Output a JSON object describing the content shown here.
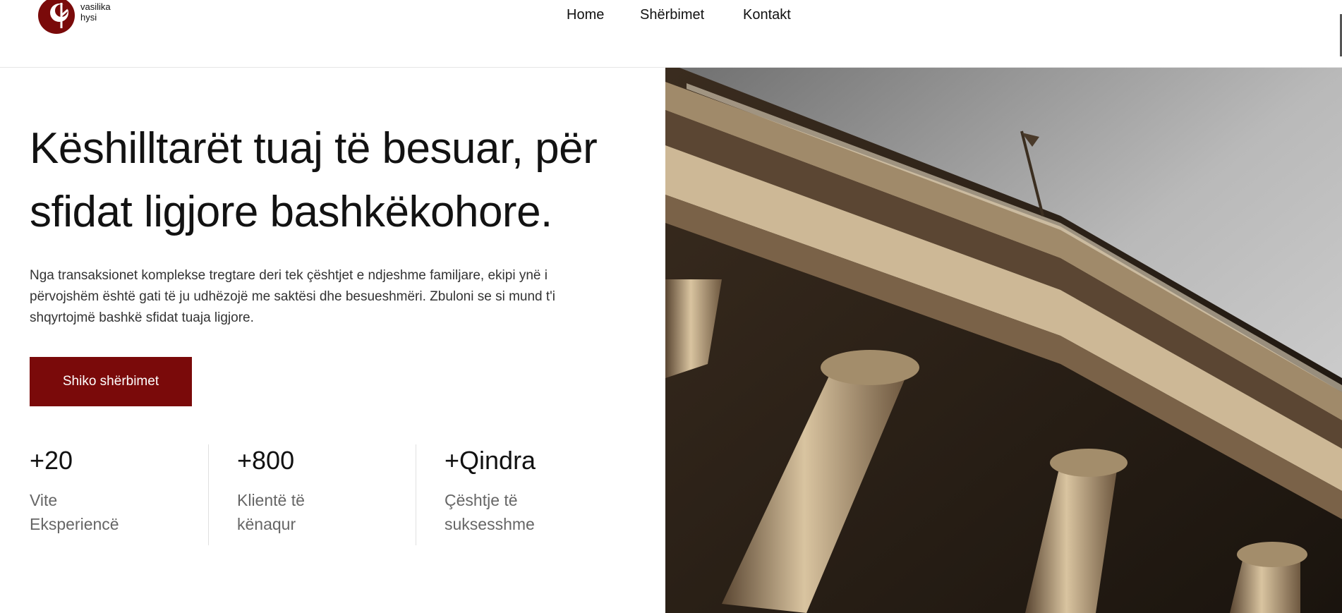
{
  "brand": {
    "line1": "vasilika",
    "line2": "hysi",
    "color": "#7a0a0a"
  },
  "nav": {
    "items": [
      "Home",
      "Shërbimet",
      "Kontakt"
    ]
  },
  "hero": {
    "title": "Këshilltarët tuaj të besuar, për sfidat ligjore bashkëkohore.",
    "lead": "Nga transaksionet komplekse tregtare deri tek çështjet e ndjeshme familjare, ekipi ynë i përvojshëm është gati të ju udhëzojë me saktësi dhe besueshmëri. Zbuloni se si mund t'i shqyrtojmë bashkë sfidat tuaja ligjore.",
    "cta": "Shiko shërbimet",
    "image": "neoclassical-building-columns"
  },
  "stats": [
    {
      "number": "+20",
      "label": "Vite  Eksperiencë"
    },
    {
      "number": "+800",
      "label": "Klientë të kënaqur"
    },
    {
      "number": "+Qindra",
      "label": "Çështje të suksesshme"
    }
  ]
}
